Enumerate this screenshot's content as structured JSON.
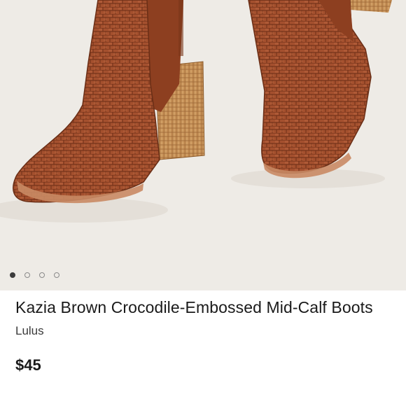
{
  "carousel": {
    "image_alt": "Brown crocodile-embossed mid-calf boots with stacked block heels",
    "slide_count": 4,
    "active_index": 0
  },
  "product": {
    "title": "Kazia Brown Crocodile-Embossed Mid-Calf Boots",
    "brand": "Lulus",
    "price": "$45"
  },
  "colors": {
    "background": "#eeebe6",
    "boot_leather": "#a4502e",
    "heel_wood": "#c58f56"
  }
}
